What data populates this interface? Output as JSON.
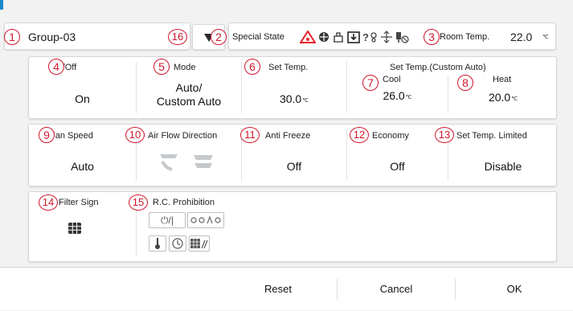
{
  "header": {
    "group_name": "Group-03",
    "special_state_label": "Special State",
    "room_temp_label": "Room Temp.",
    "room_temp_value": "22.0",
    "temp_unit": "℃"
  },
  "callouts": [
    "1",
    "2",
    "3",
    "4",
    "5",
    "6",
    "7",
    "8",
    "9",
    "10",
    "11",
    "12",
    "13",
    "14",
    "15",
    "16"
  ],
  "row1": {
    "onoff": {
      "label": "On/Off",
      "value": "On"
    },
    "mode": {
      "label": "Mode",
      "value_line1": "Auto/",
      "value_line2": "Custom Auto"
    },
    "set_temp": {
      "label": "Set Temp.",
      "value": "30.0"
    },
    "custom_auto": {
      "label": "Set Temp.(Custom Auto)",
      "cool_label": "Cool",
      "cool_value": "26.0",
      "heat_label": "Heat",
      "heat_value": "20.0"
    }
  },
  "row2": {
    "fan_speed": {
      "label": "Fan Speed",
      "value": "Auto"
    },
    "air_flow": {
      "label": "Air Flow Direction"
    },
    "anti_freeze": {
      "label": "Anti Freeze",
      "value": "Off"
    },
    "economy": {
      "label": "Economy",
      "value": "Off"
    },
    "set_temp_limited": {
      "label": "Set Temp. Limited",
      "value": "Disable"
    }
  },
  "row3": {
    "filter_sign": {
      "label": "Filter Sign",
      "icon": "filter-grid-icon"
    },
    "rc_prohibition": {
      "label": "R.C. Prohibition",
      "buttons": [
        "power-toggle-icon",
        "mode-icons",
        "thermometer-icon",
        "timer-icon",
        "filter-reset-icon"
      ],
      "power_text": "⏻/|"
    }
  },
  "footer": {
    "reset": "Reset",
    "cancel": "Cancel",
    "ok": "OK"
  },
  "colors": {
    "accent": "#1e88c8",
    "callout": "#d0162a",
    "warning": "#e8202a"
  }
}
